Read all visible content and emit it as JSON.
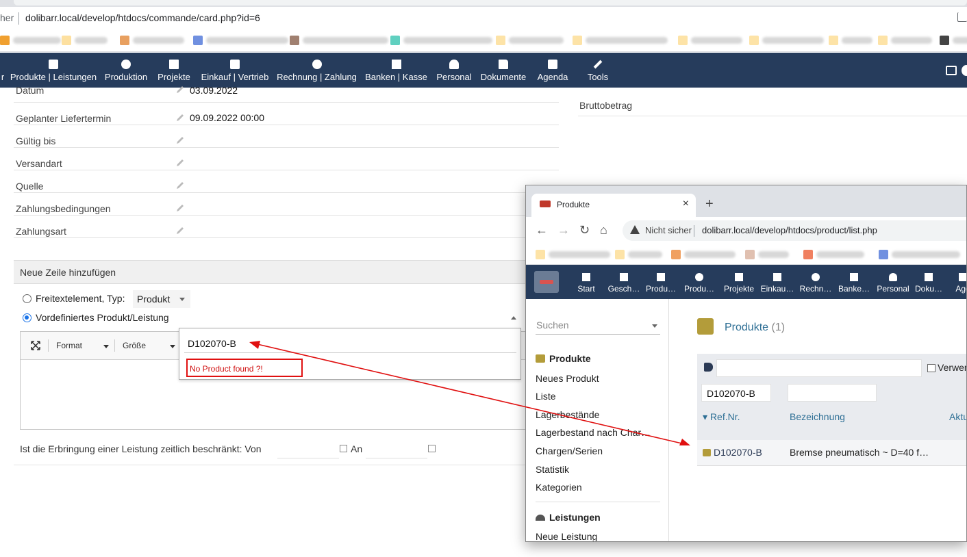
{
  "main_browser": {
    "secure_label": "her",
    "url": "dolibarr.local/develop/htdocs/commande/card.php?id=6"
  },
  "topnav": {
    "items": [
      {
        "label": "r",
        "icon": "cut-icon"
      },
      {
        "label": "Produkte | Leistungen",
        "icon": "box-icon"
      },
      {
        "label": "Produktion",
        "icon": "cubes-icon"
      },
      {
        "label": "Projekte",
        "icon": "sitemap-icon"
      },
      {
        "label": "Einkauf | Vertrieb",
        "icon": "briefcase-icon"
      },
      {
        "label": "Rechnung | Zahlung",
        "icon": "coins-icon"
      },
      {
        "label": "Banken | Kasse",
        "icon": "bank-icon"
      },
      {
        "label": "Personal",
        "icon": "user-icon"
      },
      {
        "label": "Dokumente",
        "icon": "folder-icon"
      },
      {
        "label": "Agenda",
        "icon": "calendar-icon"
      },
      {
        "label": "Tools",
        "icon": "wrench-icon"
      }
    ]
  },
  "form": {
    "rows": [
      {
        "label": "Datum",
        "value": "03.09.2022"
      },
      {
        "label": "Geplanter Liefertermin",
        "value": "09.09.2022 00:00"
      },
      {
        "label": "Gültig bis",
        "value": ""
      },
      {
        "label": "Versandart",
        "value": ""
      },
      {
        "label": "Quelle",
        "value": ""
      },
      {
        "label": "Zahlungsbedingungen",
        "value": ""
      },
      {
        "label": "Zahlungsart",
        "value": ""
      }
    ],
    "right_label": "Bruttobetrag"
  },
  "add_line": {
    "header": "Neue Zeile hinzufügen",
    "option_freetext": "Freitextelement, Typ:",
    "freetext_type": "Produkt",
    "option_predefined": "Vordefiniertes Produkt/Leistung",
    "toolbar_format": "Format",
    "toolbar_size": "Größe",
    "search_value": "D102070-B",
    "not_found": "No Product found ?!",
    "service_text": "Ist die Erbringung einer Leistung zeitlich beschränkt: Von",
    "service_to": "An"
  },
  "second_window": {
    "tab_title": "Produkte",
    "not_secure": "Nicht sicher",
    "url": "dolibarr.local/develop/htdocs/product/list.php",
    "nav": [
      {
        "label": "Start",
        "icon": "home-icon"
      },
      {
        "label": "Gesch…",
        "icon": "building-icon"
      },
      {
        "label": "Produ…",
        "icon": "box-icon"
      },
      {
        "label": "Produ…",
        "icon": "cubes-icon"
      },
      {
        "label": "Projekte",
        "icon": "sitemap-icon"
      },
      {
        "label": "Einkau…",
        "icon": "briefcase-icon"
      },
      {
        "label": "Rechn…",
        "icon": "coins-icon"
      },
      {
        "label": "Banke…",
        "icon": "bank-icon"
      },
      {
        "label": "Personal",
        "icon": "user-icon"
      },
      {
        "label": "Doku…",
        "icon": "folder-icon"
      },
      {
        "label": "Age",
        "icon": "calendar-icon"
      }
    ],
    "sidebar": {
      "search_placeholder": "Suchen",
      "section1": "Produkte",
      "links": [
        "Neues Produkt",
        "Liste",
        "Lagerbestände",
        "Lagerbestand nach Char…",
        "Chargen/Serien",
        "Statistik",
        "Kategorien"
      ],
      "section2": "Leistungen",
      "links2": [
        "Neue Leistung"
      ]
    },
    "main": {
      "title": "Produkte",
      "count": "(1)",
      "filter_ref": "D102070-B",
      "filter_desc": "",
      "verwendet_label": "Verwen",
      "col_ref": "Ref.Nr.",
      "col_desc": "Bezeichnung",
      "col_akt": "Aktu",
      "row_ref": "D102070-B",
      "row_desc": "Bremse pneumatisch ~ D=40 f…"
    }
  },
  "colors": {
    "nav_bg": "#263c5c",
    "link_blue": "#2e6f95",
    "annotation_red": "#e01010",
    "product_gold": "#b39c3a"
  }
}
